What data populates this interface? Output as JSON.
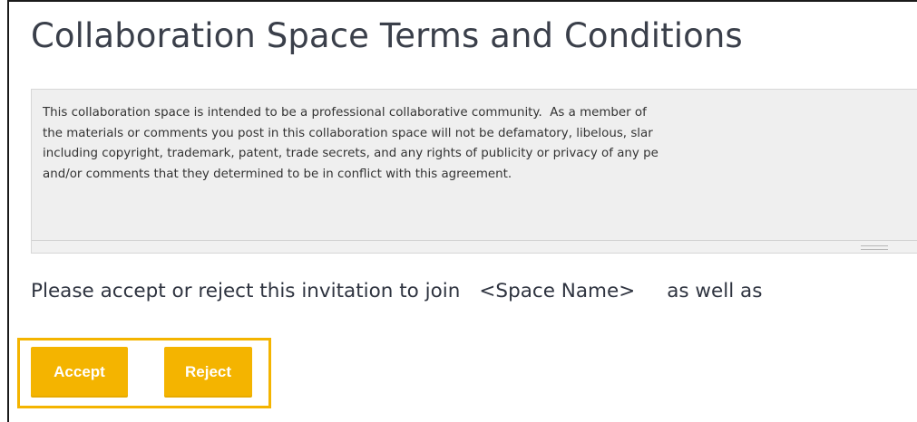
{
  "page": {
    "title": "Collaboration Space Terms and Conditions"
  },
  "terms": {
    "lines": [
      "This collaboration space is intended to be a professional collaborative community.  As a member of",
      "the materials or comments you post in this collaboration space will not be defamatory, libelous, slar",
      "including copyright, trademark, patent, trade secrets, and any rights of publicity or privacy of any pe",
      "and/or comments that they determined to be in conflict with this agreement."
    ]
  },
  "invitation": {
    "prefix": "Please accept or reject this invitation to join",
    "space_name": "<Space Name>",
    "suffix": "as well as"
  },
  "actions": {
    "accept_label": "Accept",
    "reject_label": "Reject"
  },
  "colors": {
    "accent": "#f4b400",
    "title_text": "#3a3f4a",
    "terms_background": "#efefef"
  }
}
